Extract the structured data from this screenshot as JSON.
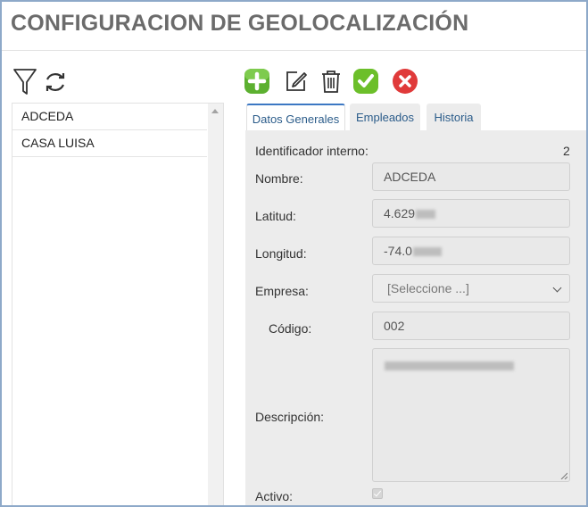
{
  "page": {
    "title": "CONFIGURACION DE GEOLOCALIZACIÓN"
  },
  "left_toolbar": {
    "icons": [
      "filter-icon",
      "refresh-icon"
    ]
  },
  "list": {
    "items": [
      "ADCEDA",
      "CASA LUISA"
    ]
  },
  "toolbar": {
    "icons": [
      "add-icon",
      "edit-icon",
      "delete-icon",
      "save-icon",
      "cancel-icon"
    ]
  },
  "tabs": [
    {
      "label": "Datos Generales",
      "active": true
    },
    {
      "label": "Empleados",
      "active": false
    },
    {
      "label": "Historia",
      "active": false
    }
  ],
  "form": {
    "internal_id_label": "Identificador interno:",
    "internal_id_value": "2",
    "name_label": "Nombre:",
    "name_value": "ADCEDA",
    "latitude_label": "Latitud:",
    "latitude_value": "4.629",
    "longitude_label": "Longitud:",
    "longitude_value": "-74.0",
    "company_label": "Empresa:",
    "company_placeholder": "[Seleccione ...]",
    "code_label": "Código:",
    "code_value": "002",
    "description_label": "Descripción:",
    "active_label": "Activo:",
    "active_checked": true
  },
  "colors": {
    "add": "#5cb030",
    "save": "#6cbf2a",
    "cancel": "#e03a3a",
    "tab_accent": "#3c78c3"
  }
}
